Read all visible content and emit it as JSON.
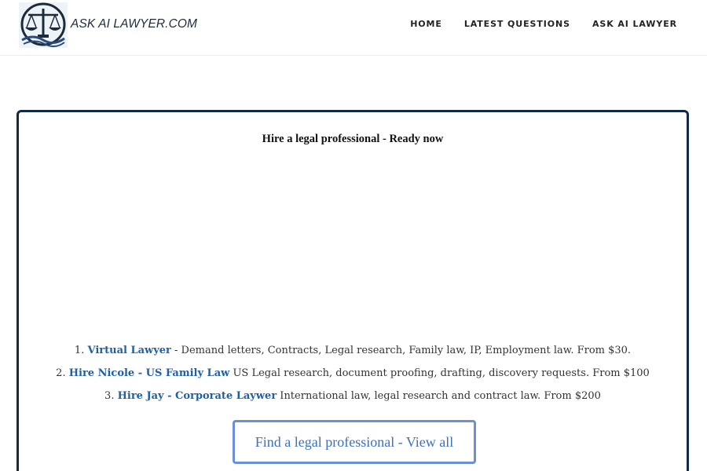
{
  "header": {
    "logo_text": "ASK AI LAWYER.COM",
    "nav": [
      {
        "label": "HOME"
      },
      {
        "label": "LATEST QUESTIONS"
      },
      {
        "label": "ASK AI LAWYER"
      }
    ]
  },
  "card": {
    "title": "Hire a legal professional - Ready now",
    "items": [
      {
        "number": "1.",
        "link": "Virtual Lawyer",
        "text": " - Demand letters, Contracts, Legal research, Family law, IP, Employment law. From $30."
      },
      {
        "number": "2.",
        "link": "Hire Nicole - US Family Law",
        "text": " US Legal research, document proofing, drafting, discovery requests. From $100"
      },
      {
        "number": "3.",
        "link": "Hire Jay - Corporate Laywer",
        "text": " International law, legal research and contract law. From $200"
      }
    ],
    "cta_label": "Find a legal professional - View all"
  },
  "colors": {
    "brand_navy": "#132a45",
    "link_blue": "#1f5fa5",
    "cta_border": "#6b8fd8",
    "cta_text": "#3f6fc1"
  },
  "icons": {
    "logo": "scales-of-justice-icon"
  }
}
